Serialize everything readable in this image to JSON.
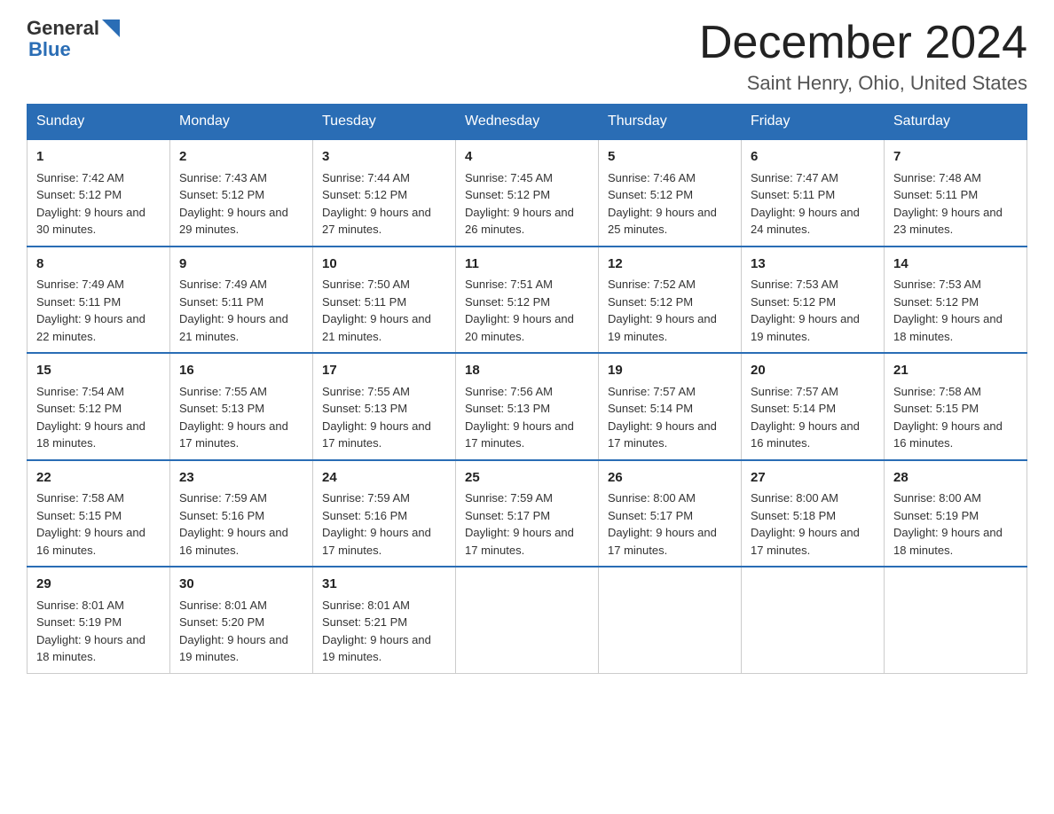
{
  "header": {
    "title": "December 2024",
    "location": "Saint Henry, Ohio, United States",
    "logo_general": "General",
    "logo_blue": "Blue"
  },
  "days_of_week": [
    "Sunday",
    "Monday",
    "Tuesday",
    "Wednesday",
    "Thursday",
    "Friday",
    "Saturday"
  ],
  "weeks": [
    [
      {
        "day": "1",
        "sunrise": "7:42 AM",
        "sunset": "5:12 PM",
        "daylight": "9 hours and 30 minutes."
      },
      {
        "day": "2",
        "sunrise": "7:43 AM",
        "sunset": "5:12 PM",
        "daylight": "9 hours and 29 minutes."
      },
      {
        "day": "3",
        "sunrise": "7:44 AM",
        "sunset": "5:12 PM",
        "daylight": "9 hours and 27 minutes."
      },
      {
        "day": "4",
        "sunrise": "7:45 AM",
        "sunset": "5:12 PM",
        "daylight": "9 hours and 26 minutes."
      },
      {
        "day": "5",
        "sunrise": "7:46 AM",
        "sunset": "5:12 PM",
        "daylight": "9 hours and 25 minutes."
      },
      {
        "day": "6",
        "sunrise": "7:47 AM",
        "sunset": "5:11 PM",
        "daylight": "9 hours and 24 minutes."
      },
      {
        "day": "7",
        "sunrise": "7:48 AM",
        "sunset": "5:11 PM",
        "daylight": "9 hours and 23 minutes."
      }
    ],
    [
      {
        "day": "8",
        "sunrise": "7:49 AM",
        "sunset": "5:11 PM",
        "daylight": "9 hours and 22 minutes."
      },
      {
        "day": "9",
        "sunrise": "7:49 AM",
        "sunset": "5:11 PM",
        "daylight": "9 hours and 21 minutes."
      },
      {
        "day": "10",
        "sunrise": "7:50 AM",
        "sunset": "5:11 PM",
        "daylight": "9 hours and 21 minutes."
      },
      {
        "day": "11",
        "sunrise": "7:51 AM",
        "sunset": "5:12 PM",
        "daylight": "9 hours and 20 minutes."
      },
      {
        "day": "12",
        "sunrise": "7:52 AM",
        "sunset": "5:12 PM",
        "daylight": "9 hours and 19 minutes."
      },
      {
        "day": "13",
        "sunrise": "7:53 AM",
        "sunset": "5:12 PM",
        "daylight": "9 hours and 19 minutes."
      },
      {
        "day": "14",
        "sunrise": "7:53 AM",
        "sunset": "5:12 PM",
        "daylight": "9 hours and 18 minutes."
      }
    ],
    [
      {
        "day": "15",
        "sunrise": "7:54 AM",
        "sunset": "5:12 PM",
        "daylight": "9 hours and 18 minutes."
      },
      {
        "day": "16",
        "sunrise": "7:55 AM",
        "sunset": "5:13 PM",
        "daylight": "9 hours and 17 minutes."
      },
      {
        "day": "17",
        "sunrise": "7:55 AM",
        "sunset": "5:13 PM",
        "daylight": "9 hours and 17 minutes."
      },
      {
        "day": "18",
        "sunrise": "7:56 AM",
        "sunset": "5:13 PM",
        "daylight": "9 hours and 17 minutes."
      },
      {
        "day": "19",
        "sunrise": "7:57 AM",
        "sunset": "5:14 PM",
        "daylight": "9 hours and 17 minutes."
      },
      {
        "day": "20",
        "sunrise": "7:57 AM",
        "sunset": "5:14 PM",
        "daylight": "9 hours and 16 minutes."
      },
      {
        "day": "21",
        "sunrise": "7:58 AM",
        "sunset": "5:15 PM",
        "daylight": "9 hours and 16 minutes."
      }
    ],
    [
      {
        "day": "22",
        "sunrise": "7:58 AM",
        "sunset": "5:15 PM",
        "daylight": "9 hours and 16 minutes."
      },
      {
        "day": "23",
        "sunrise": "7:59 AM",
        "sunset": "5:16 PM",
        "daylight": "9 hours and 16 minutes."
      },
      {
        "day": "24",
        "sunrise": "7:59 AM",
        "sunset": "5:16 PM",
        "daylight": "9 hours and 17 minutes."
      },
      {
        "day": "25",
        "sunrise": "7:59 AM",
        "sunset": "5:17 PM",
        "daylight": "9 hours and 17 minutes."
      },
      {
        "day": "26",
        "sunrise": "8:00 AM",
        "sunset": "5:17 PM",
        "daylight": "9 hours and 17 minutes."
      },
      {
        "day": "27",
        "sunrise": "8:00 AM",
        "sunset": "5:18 PM",
        "daylight": "9 hours and 17 minutes."
      },
      {
        "day": "28",
        "sunrise": "8:00 AM",
        "sunset": "5:19 PM",
        "daylight": "9 hours and 18 minutes."
      }
    ],
    [
      {
        "day": "29",
        "sunrise": "8:01 AM",
        "sunset": "5:19 PM",
        "daylight": "9 hours and 18 minutes."
      },
      {
        "day": "30",
        "sunrise": "8:01 AM",
        "sunset": "5:20 PM",
        "daylight": "9 hours and 19 minutes."
      },
      {
        "day": "31",
        "sunrise": "8:01 AM",
        "sunset": "5:21 PM",
        "daylight": "9 hours and 19 minutes."
      },
      null,
      null,
      null,
      null
    ]
  ]
}
